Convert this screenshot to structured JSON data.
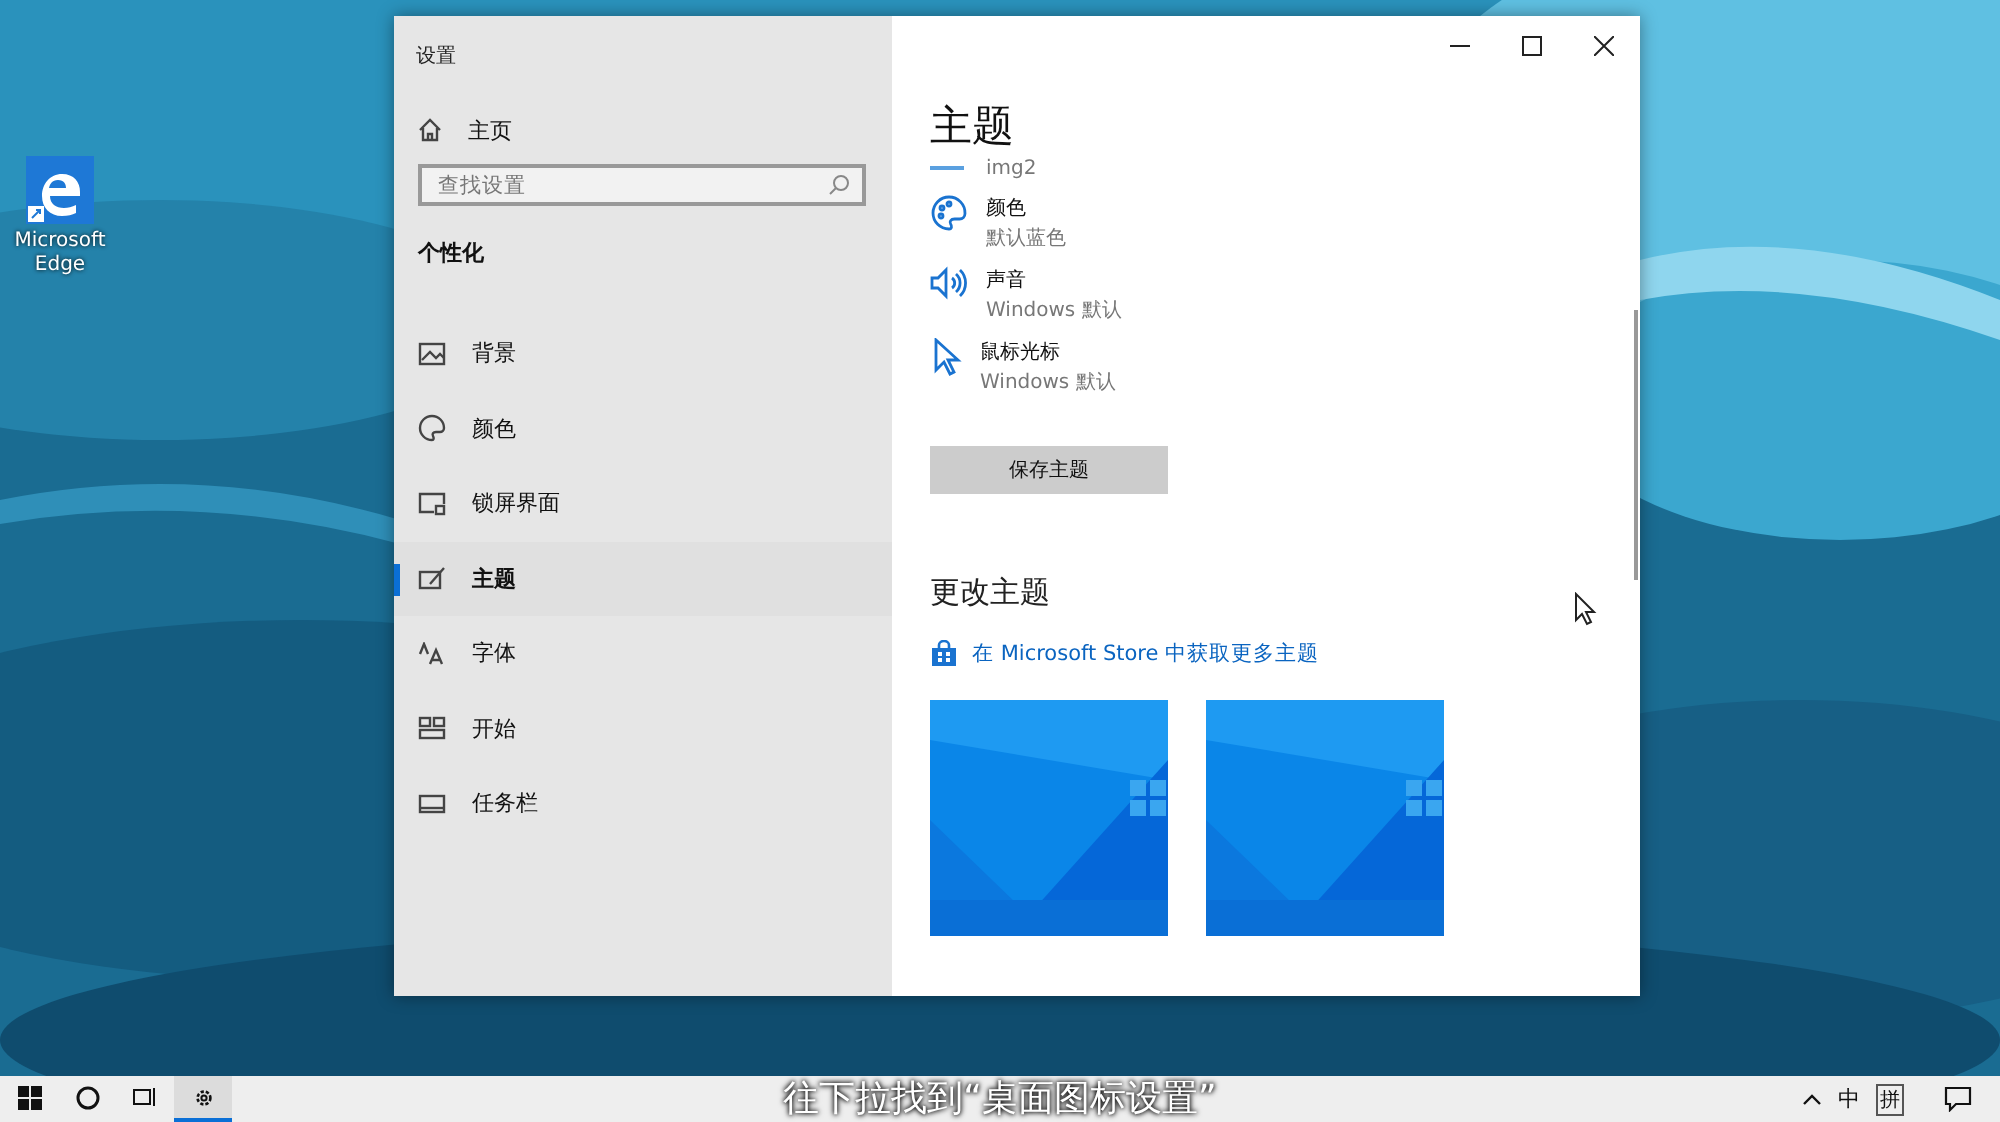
{
  "desktop": {
    "icons": [
      {
        "label": "Microsoft Edge"
      }
    ]
  },
  "window": {
    "title": "设置"
  },
  "sidebar": {
    "home": "主页",
    "search": {
      "placeholder": "查找设置"
    },
    "section": "个性化",
    "items": [
      {
        "label": "背景",
        "selected": false
      },
      {
        "label": "颜色",
        "selected": false
      },
      {
        "label": "锁屏界面",
        "selected": false
      },
      {
        "label": "主题",
        "selected": true
      },
      {
        "label": "字体",
        "selected": false
      },
      {
        "label": "开始",
        "selected": false
      },
      {
        "label": "任务栏",
        "selected": false
      }
    ]
  },
  "content": {
    "title": "主题",
    "background_value": "img2",
    "properties": [
      {
        "name": "颜色",
        "value": "默认蓝色"
      },
      {
        "name": "声音",
        "value": "Windows 默认"
      },
      {
        "name": "鼠标光标",
        "value": "Windows 默认"
      }
    ],
    "save_button": "保存主题",
    "change_heading": "更改主题",
    "store_link": "在 Microsoft Store 中获取更多主题"
  },
  "caption": "往下拉找到“桌面图标设置”",
  "taskbar": {
    "apps": [
      {
        "selected": false
      },
      {
        "selected": false
      },
      {
        "selected": false
      },
      {
        "selected": true
      }
    ],
    "ime": "中",
    "ime_mode": "拼"
  }
}
